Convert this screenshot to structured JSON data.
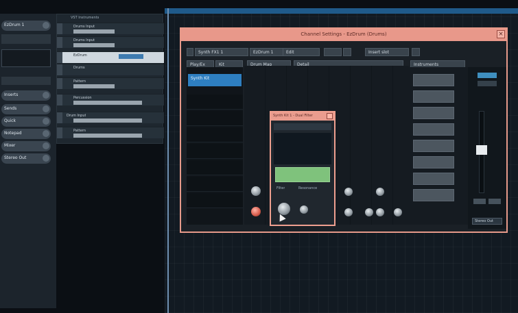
{
  "window": {
    "title": "Channel Settings - EzDrum (Drums)"
  },
  "toolbar": {
    "preset_dropdown": "Synth FX1 1",
    "channel_dropdown": "EzDrum 1",
    "edit_menu": "Edit",
    "insert_dropdown": "Insert slot"
  },
  "browser": {
    "tab_play": "Play/Ex",
    "tab_kit": "Kit",
    "selected_preset": "Synth Kit"
  },
  "center": {
    "tab_drum": "Drum Map",
    "tab_detail": "Detail"
  },
  "right_panel": {
    "header": "Instruments"
  },
  "popup": {
    "title": "Synth Kit 1 - Dual Filter",
    "label_a": "Filter",
    "label_b": "Resonance"
  },
  "tracks": {
    "header": "VST Instruments",
    "items": [
      "Drums Input",
      "Drums Input",
      "EzDrum",
      "Drums",
      "Pattern",
      "Percussion",
      "Drum Input",
      "Pattern"
    ]
  },
  "inspector": {
    "buttons": [
      "EzDrum 1",
      "Inserts",
      "Sends",
      "Quick",
      "Notepad",
      "Mixer"
    ]
  },
  "mixer": {
    "output": "Stereo Out"
  },
  "colors": {
    "accent_window_frame": "#e79a8a",
    "selection_blue": "#2e7fc1",
    "screen_green": "#7fc27c",
    "ruler_blue": "#1f5a8a"
  }
}
